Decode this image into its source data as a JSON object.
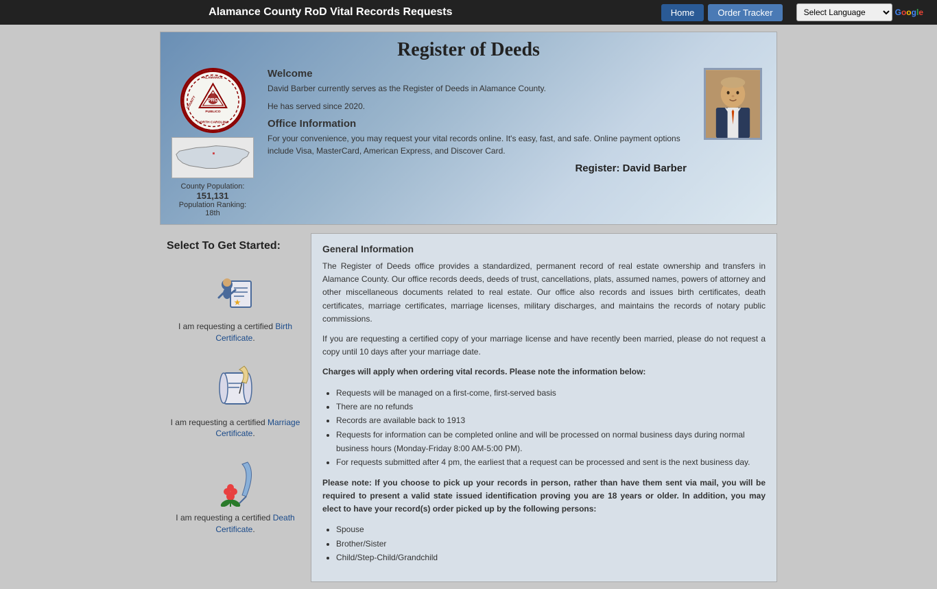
{
  "nav": {
    "site_title": "Alamance County RoD Vital Records Requests",
    "home_label": "Home",
    "order_tracker_label": "Order Tracker",
    "language_select_label": "Select Language",
    "google_label": "Google"
  },
  "header": {
    "title": "Register of Deeds",
    "welcome_title": "Welcome",
    "welcome_text1": "David Barber currently serves as the Register of Deeds in Alamance County.",
    "welcome_text2": "He has served since 2020.",
    "office_info_title": "Office Information",
    "office_info_text": "For your convenience, you may request your vital records online.  It's easy, fast, and safe.  Online payment options include Visa, MasterCard, American Express, and Discover Card.",
    "register_name": "Register: David Barber",
    "county_population_label": "County Population:",
    "county_population_value": "151,131",
    "population_ranking_label": "Population Ranking:",
    "population_ranking_value": "18th",
    "seal_text": "ALAMANCE COUNTY NORTH CAROLINA"
  },
  "sidebar": {
    "heading": "Select To Get Started:",
    "birth": {
      "label_prefix": "I am requesting a certified ",
      "link_text": "Birth Certificate",
      "label_suffix": "."
    },
    "marriage": {
      "label_prefix": "I am requesting a certified ",
      "link_text": "Marriage Certificate",
      "label_suffix": "."
    },
    "death": {
      "label_prefix": "I am requesting a certified ",
      "link_text": "Death Certificate",
      "label_suffix": "."
    }
  },
  "main": {
    "general_info_title": "General Information",
    "para1": "The Register of Deeds office provides a standardized, permanent record of real estate ownership and transfers in Alamance County. Our office records deeds, deeds of trust, cancellations, plats, assumed names, powers of attorney and other miscellaneous documents related to real estate. Our office also records and issues birth certificates, death certificates, marriage certificates, marriage licenses, military discharges, and maintains the records of notary public commissions.",
    "para2": "If you are requesting a certified copy of your marriage license and have recently been married, please do not request a copy until 10 days after your marriage date.",
    "charges_label": "Charges will apply when ordering vital records. Please note the information below:",
    "bullets": [
      "Requests will be managed on a first-come, first-served basis",
      "There are no refunds",
      "Records are available back to 1913",
      "Requests for information can be completed online and will be processed on normal business days during normal business hours (Monday-Friday 8:00 AM-5:00 PM).",
      "For requests submitted after 4 pm, the earliest that a request can be processed and sent is the next business day."
    ],
    "note": "Please note: If you choose to pick up your records in person, rather than have them sent via mail, you will be required to present a valid state issued identification proving you are 18 years or older. In addition, you may elect to have your record(s) order picked up by the following persons:",
    "pickup_persons": [
      "Spouse",
      "Brother/Sister",
      "Child/Step-Child/Grandchild"
    ]
  }
}
